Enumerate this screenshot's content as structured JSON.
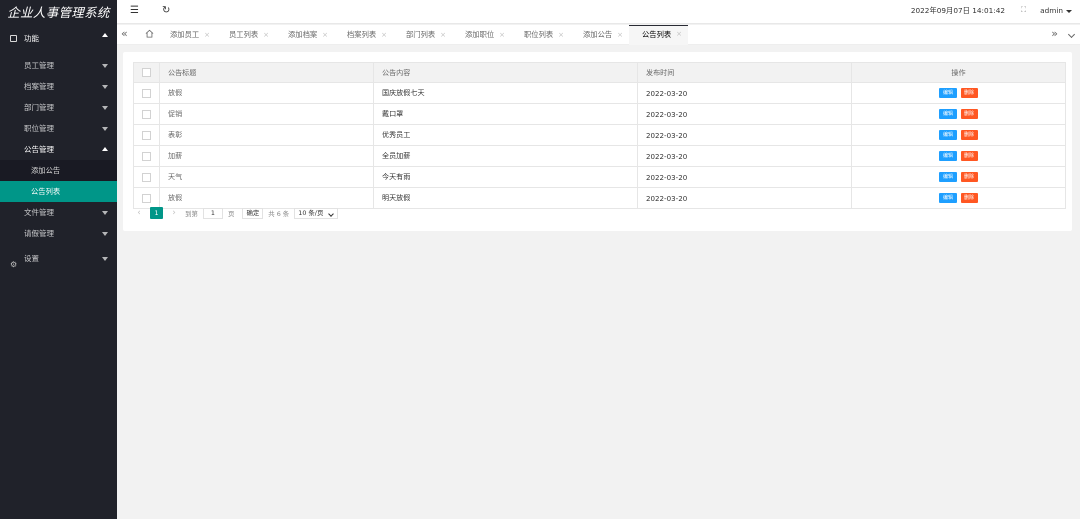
{
  "app": {
    "title": "企业人事管理系统"
  },
  "sidebar": {
    "top_label": "功能",
    "groups": [
      {
        "label": "员工管理"
      },
      {
        "label": "档案管理"
      },
      {
        "label": "部门管理"
      },
      {
        "label": "职位管理"
      },
      {
        "label": "公告管理",
        "open": true,
        "children": [
          "添加公告",
          "公告列表"
        ]
      },
      {
        "label": "文件管理"
      },
      {
        "label": "请假管理"
      }
    ],
    "settings_label": "设置"
  },
  "header": {
    "datetime": "2022年09月07日  14:01:42",
    "user": "admin"
  },
  "tabs": [
    "添加员工",
    "员工列表",
    "添加档案",
    "档案列表",
    "部门列表",
    "添加职位",
    "职位列表",
    "添加公告",
    "公告列表"
  ],
  "active_tab": "公告列表",
  "table": {
    "headers": [
      "公告标题",
      "公告内容",
      "发布时间",
      "操作"
    ],
    "edit_label": "编辑",
    "delete_label": "删除",
    "rows": [
      {
        "title": "放假",
        "content": "国庆放假七天",
        "date": "2022-03-20"
      },
      {
        "title": "促销",
        "content": "戴口罩",
        "date": "2022-03-20"
      },
      {
        "title": "表彰",
        "content": "优秀员工",
        "date": "2022-03-20"
      },
      {
        "title": "加薪",
        "content": "全员加薪",
        "date": "2022-03-20"
      },
      {
        "title": "天气",
        "content": "今天有雨",
        "date": "2022-03-20"
      },
      {
        "title": "放假",
        "content": "明天放假",
        "date": "2022-03-20"
      }
    ]
  },
  "pager": {
    "current": "1",
    "goto_label": "到第",
    "page_input": "1",
    "page_unit": "页",
    "confirm_label": "确定",
    "total": "共 6 条",
    "page_size": "10 条/页"
  },
  "colors": {
    "sidebar_bg": "#20222a",
    "accent": "#009688",
    "edit": "#1e9fff",
    "delete": "#ff5722"
  }
}
